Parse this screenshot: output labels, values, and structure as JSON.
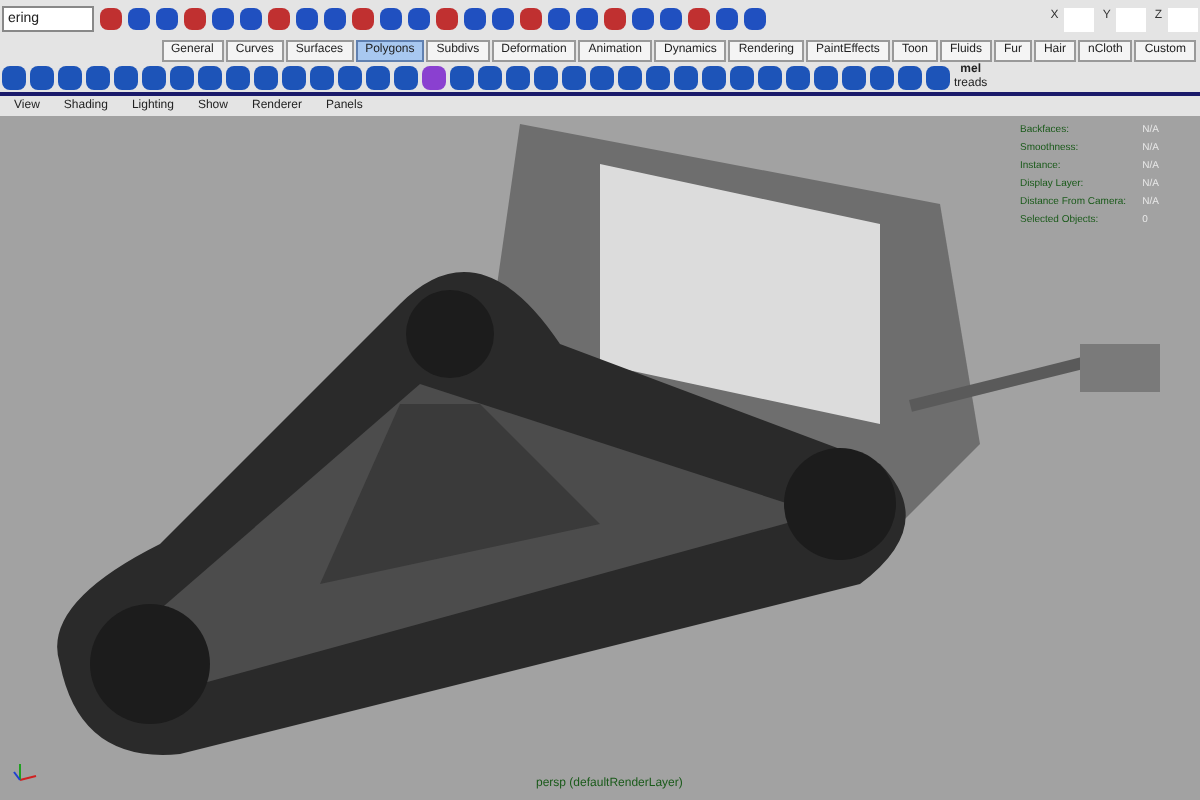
{
  "status_line": {
    "mode_menu": "ering",
    "coord_labels": [
      "X",
      "Y",
      "Z"
    ]
  },
  "shelf_tabs": [
    {
      "label": "General",
      "selected": false
    },
    {
      "label": "Curves",
      "selected": false
    },
    {
      "label": "Surfaces",
      "selected": false
    },
    {
      "label": "Polygons",
      "selected": true
    },
    {
      "label": "Subdivs",
      "selected": false
    },
    {
      "label": "Deformation",
      "selected": false
    },
    {
      "label": "Animation",
      "selected": false
    },
    {
      "label": "Dynamics",
      "selected": false
    },
    {
      "label": "Rendering",
      "selected": false
    },
    {
      "label": "PaintEffects",
      "selected": false
    },
    {
      "label": "Toon",
      "selected": false
    },
    {
      "label": "Fluids",
      "selected": false
    },
    {
      "label": "Fur",
      "selected": false
    },
    {
      "label": "Hair",
      "selected": false
    },
    {
      "label": "nCloth",
      "selected": false
    },
    {
      "label": "Custom",
      "selected": false
    }
  ],
  "shelf": {
    "mel_item": {
      "badge": "mel",
      "label": "treads"
    }
  },
  "panel_menu": [
    "View",
    "Shading",
    "Lighting",
    "Show",
    "Renderer",
    "Panels"
  ],
  "hud": [
    {
      "label": "Backfaces:",
      "value": "N/A"
    },
    {
      "label": "Smoothness:",
      "value": "N/A"
    },
    {
      "label": "Instance:",
      "value": "N/A"
    },
    {
      "label": "Display Layer:",
      "value": "N/A"
    },
    {
      "label": "Distance From Camera:",
      "value": "N/A"
    },
    {
      "label": "Selected Objects:",
      "value": "0"
    }
  ],
  "camera_label": "persp (defaultRenderLayer)"
}
